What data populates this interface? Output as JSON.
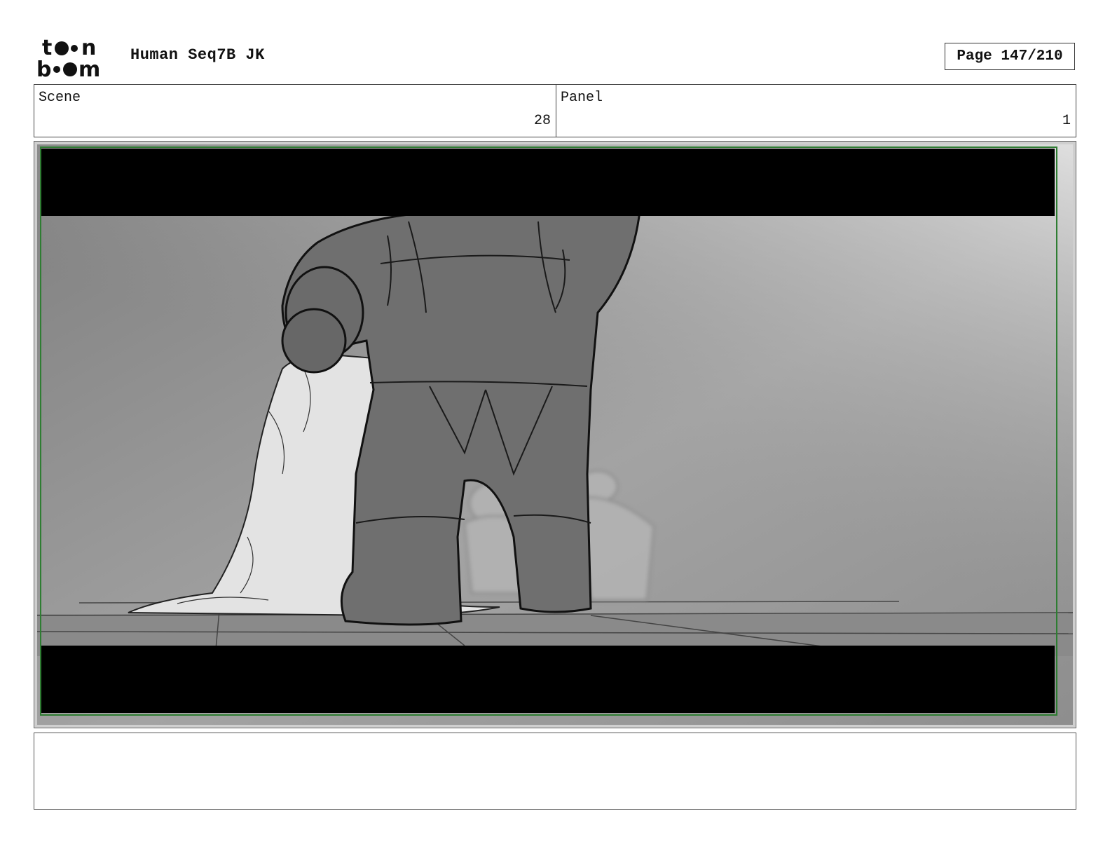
{
  "header": {
    "logo_alt": "toon boom",
    "title": "Human Seq7B JK",
    "page_label": "Page 147/210"
  },
  "meta": {
    "scene_label": "Scene",
    "scene_value": "28",
    "panel_label": "Panel",
    "panel_value": "1"
  },
  "panel_art": {
    "icon": "storyboard-sketch",
    "frame_color": "#2e7d32",
    "letterbox_color": "#000000"
  },
  "notes": {
    "text": ""
  }
}
